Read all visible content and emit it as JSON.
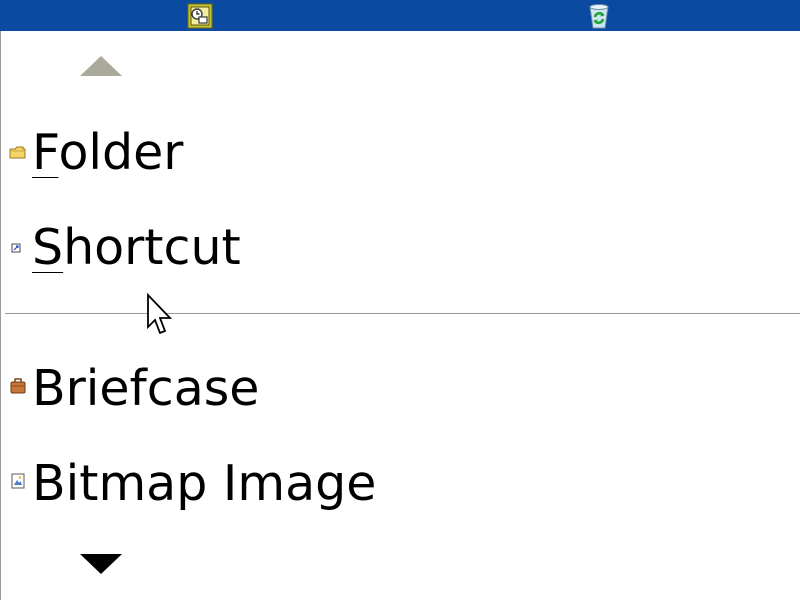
{
  "colors": {
    "taskbar": "#0a4aa0",
    "separator": "#9a9a9a",
    "scroll_up_arrow": "#aba89c",
    "scroll_down_arrow": "#000000"
  },
  "taskbar_icons": [
    "scheduled-tasks-icon",
    "recycle-bin-icon"
  ],
  "menu": {
    "items_above_separator": [
      {
        "accel": "F",
        "rest": "older",
        "icon": "folder-icon"
      },
      {
        "accel": "S",
        "rest": "hortcut",
        "icon": "shortcut-icon"
      }
    ],
    "items_below_separator": [
      {
        "label": "Briefcase",
        "icon": "briefcase-icon"
      },
      {
        "label": "Bitmap Image",
        "icon": "bitmap-image-icon"
      }
    ]
  }
}
